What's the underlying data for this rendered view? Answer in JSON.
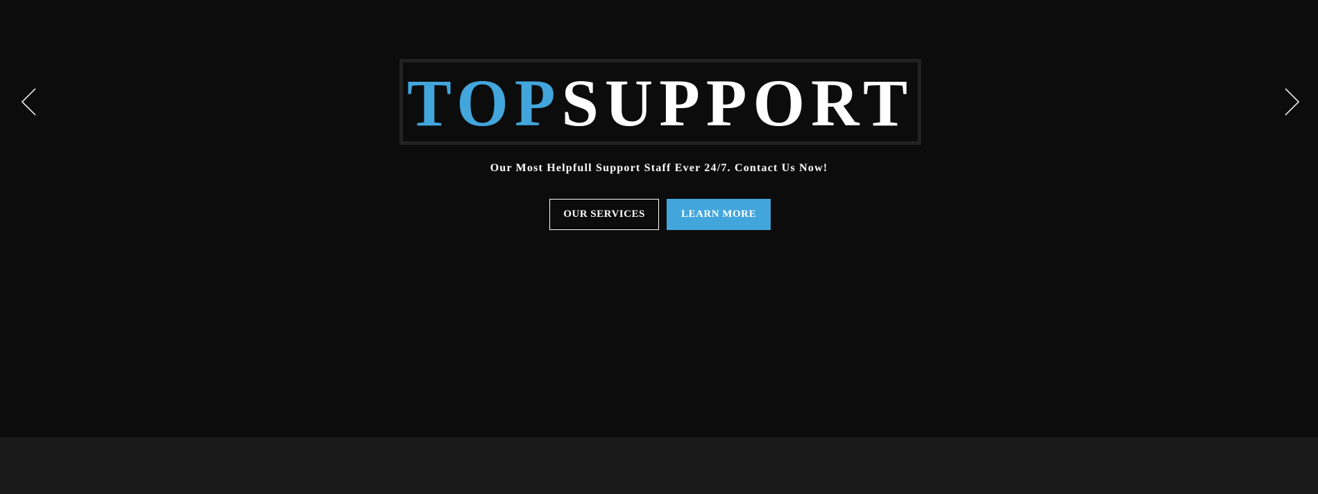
{
  "hero": {
    "logo": {
      "accent_text": "TOP",
      "main_text": "SUPPORT"
    },
    "tagline": "Our Most Helpfull Support Staff Ever 24/7. Contact Us Now!",
    "buttons": {
      "services_label": "OUR SERVICES",
      "learn_more_label": "LEARN MORE"
    },
    "nav": {
      "prev_icon": "chevron-left-icon",
      "next_icon": "chevron-right-icon"
    }
  },
  "colors": {
    "accent": "#42a5db",
    "hero_background": "#0c0c0c",
    "band_background": "#1a1a1a",
    "text": "#ffffff"
  }
}
